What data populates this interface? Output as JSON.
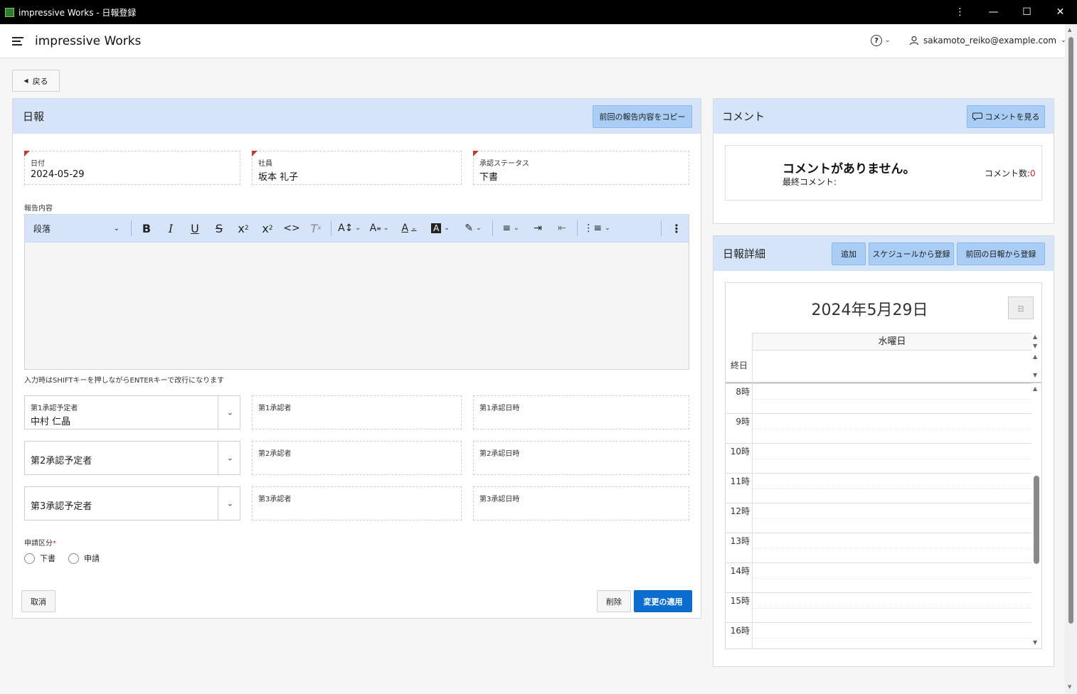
{
  "window": {
    "title": "impressive Works - 日報登録",
    "controls": [
      "⋮",
      "—",
      "☐",
      "✕"
    ]
  },
  "header": {
    "app_title": "impressive Works",
    "help_icon": "?",
    "user_email": "sakamoto_reiko@example.com"
  },
  "back_button": "戻る",
  "report_panel": {
    "title": "日報",
    "copy_button": "前回の報告内容をコピー",
    "date_label": "日付",
    "date_value": "2024-05-29",
    "employee_label": "社員",
    "employee_value": "坂本 礼子",
    "status_label": "承認ステータス",
    "status_value": "下書",
    "content_label": "報告内容",
    "editor": {
      "paragraph_select": "段落"
    },
    "hint": "入力時はSHIFTキーを押しながらENTERキーで改行になります",
    "approvers": [
      {
        "planned_label": "第1承認予定者",
        "planned_value": "中村 仁晶",
        "approver_label": "第1承認者",
        "datetime_label": "第1承認日時"
      },
      {
        "planned_placeholder": "第2承認予定者",
        "approver_label": "第2承認者",
        "datetime_label": "第2承認日時"
      },
      {
        "planned_placeholder": "第3承認予定者",
        "approver_label": "第3承認者",
        "datetime_label": "第3承認日時"
      }
    ],
    "application_label": "申請区分",
    "required_mark": "*",
    "radio_draft": "下書",
    "radio_apply": "申請",
    "cancel_button": "取消",
    "delete_button": "削除",
    "apply_button": "変更の適用"
  },
  "comment_panel": {
    "title": "コメント",
    "view_button": "コメントを見る",
    "empty_message": "コメントがありません。",
    "last_comment_label": "最終コメント:",
    "count_label": "コメント数:",
    "count_value": "0",
    "count_color": "#d32f2f"
  },
  "detail_panel": {
    "title": "日報詳細",
    "add_button": "追加",
    "from_schedule_button": "スケジュールから登録",
    "from_previous_button": "前回の日報から登録",
    "calendar": {
      "date_title": "2024年5月29日",
      "view_button": "日",
      "weekday": "水曜日",
      "all_day_label": "終日",
      "hours": [
        "8時",
        "9時",
        "10時",
        "11時",
        "12時",
        "13時",
        "14時",
        "15時",
        "16時"
      ]
    }
  },
  "colors": {
    "panel_header": "#d6e4fa",
    "primary": "#0a6ed1",
    "required": "#c0392b"
  }
}
